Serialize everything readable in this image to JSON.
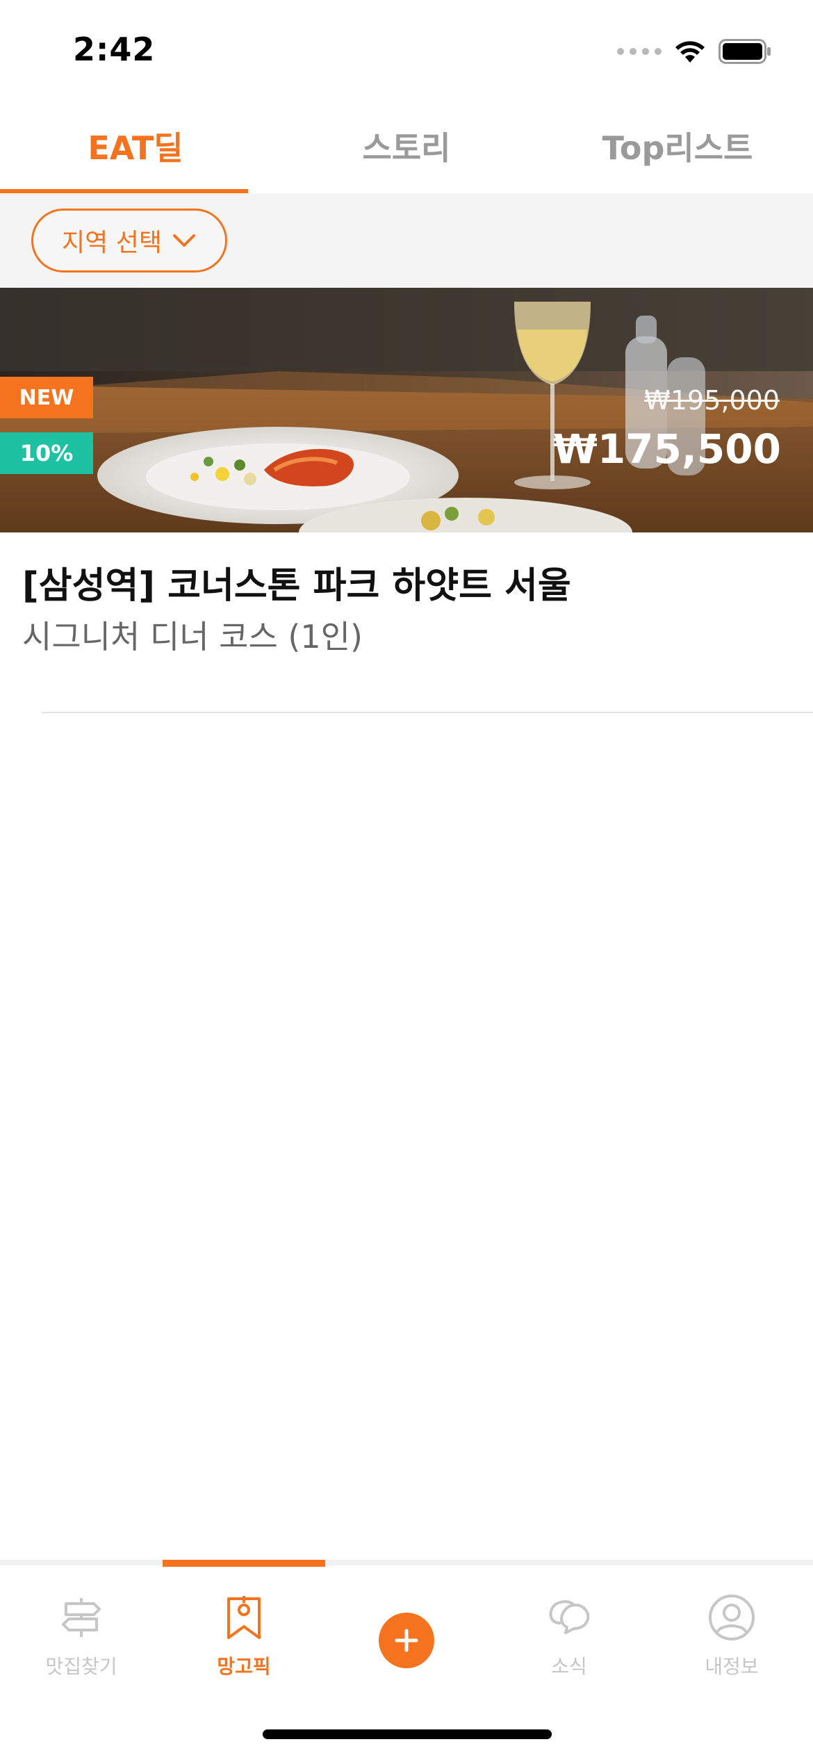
{
  "status_bar": {
    "time": "2:42"
  },
  "top_tabs": [
    {
      "label": "EAT딜",
      "active": true
    },
    {
      "label": "스토리",
      "active": false
    },
    {
      "label": "Top리스트",
      "active": false
    }
  ],
  "filter": {
    "region_label": "지역 선택"
  },
  "deal": {
    "badge_new": "NEW",
    "badge_discount": "10%",
    "original_price": "₩195,000",
    "sale_price": "₩175,500",
    "title": "[삼성역] 코너스톤 파크 하얏트 서울",
    "subtitle": "시그니처 디너 코스 (1인)"
  },
  "bottom_tabs": [
    {
      "label": "맛집찾기",
      "icon": "signpost-icon",
      "active": false
    },
    {
      "label": "망고픽",
      "icon": "tag-bookmark-icon",
      "active": true
    },
    {
      "label": "",
      "icon": "plus-icon",
      "active": false
    },
    {
      "label": "소식",
      "icon": "chat-bubbles-icon",
      "active": false
    },
    {
      "label": "내정보",
      "icon": "user-circle-icon",
      "active": false
    }
  ],
  "colors": {
    "accent": "#f5731f",
    "teal": "#1fc1a3",
    "inactive": "#c6c6c6"
  }
}
